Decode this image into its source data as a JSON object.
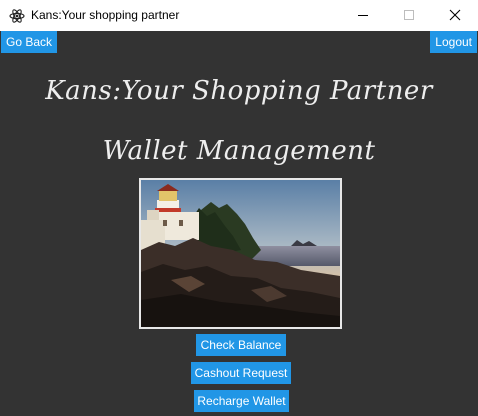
{
  "window": {
    "title": "Kans:Your shopping partner",
    "icons": {
      "app": "atom-icon",
      "minimize": "minimize-icon",
      "maximize": "maximize-icon",
      "close": "close-icon"
    }
  },
  "nav": {
    "go_back_label": "Go Back",
    "logout_label": "Logout"
  },
  "header": {
    "app_title": "Kans:Your Shopping Partner",
    "page_title": "Wallet Management"
  },
  "image": {
    "subject": "lighthouse-on-rocky-coast-at-sunset"
  },
  "actions": {
    "check_balance_label": "Check Balance",
    "cashout_label": "Cashout Request",
    "recharge_label": "Recharge Wallet"
  },
  "colors": {
    "background": "#333333",
    "accent": "#2196e6",
    "text": "#eeeeee"
  }
}
